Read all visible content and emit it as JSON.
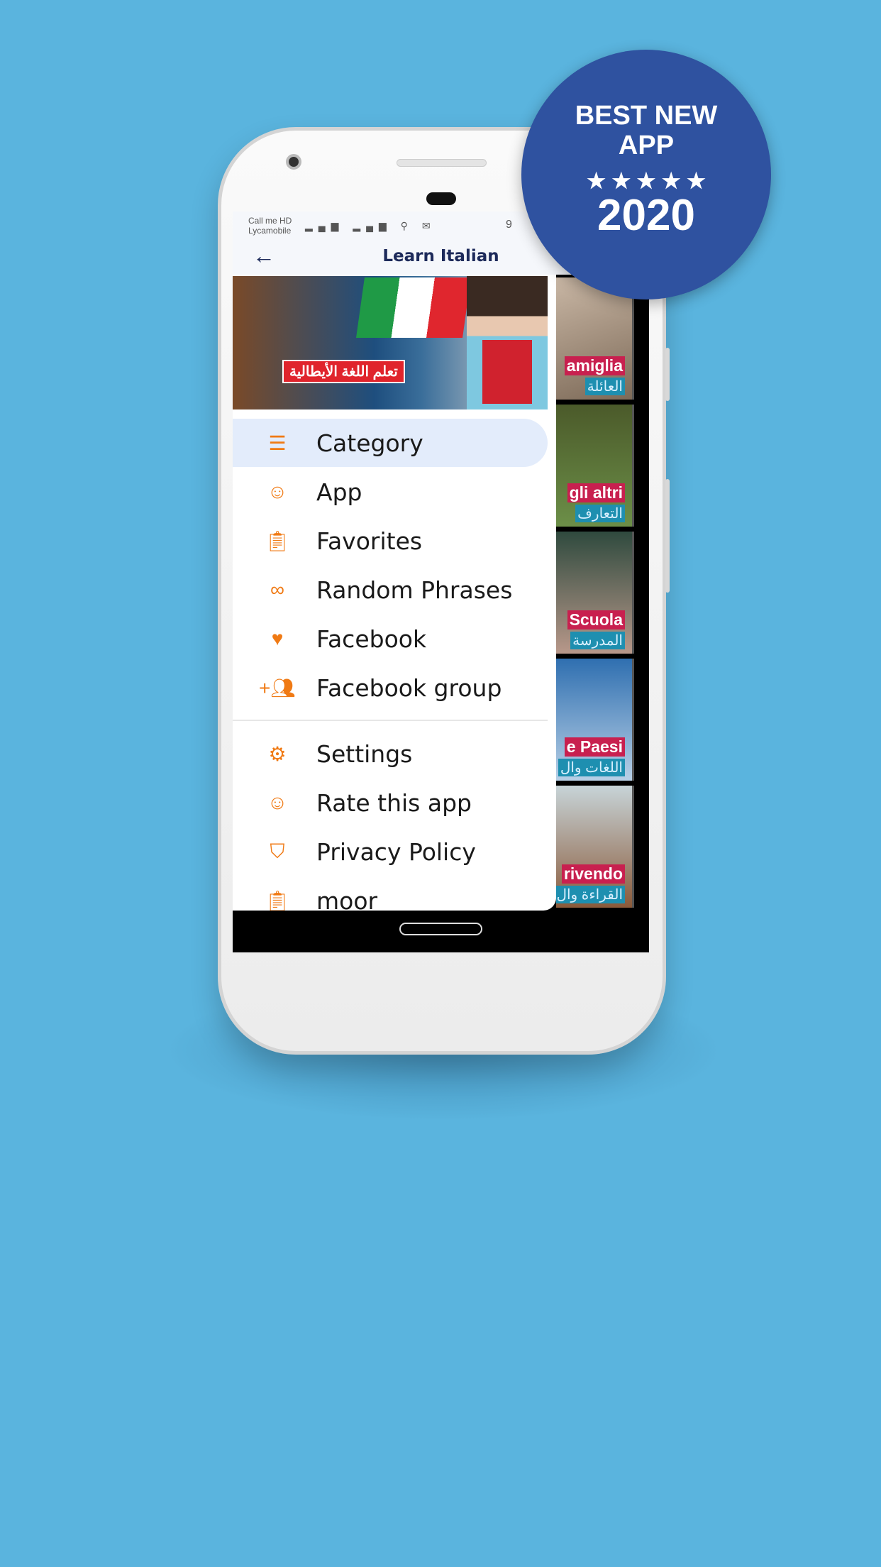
{
  "status": {
    "carrier_line1": "Call me HD",
    "carrier_line2": "Lycamobile",
    "battery": "9"
  },
  "appbar": {
    "title": "Learn Italian"
  },
  "header_banner_text": "تعلم اللغة الأيطالية",
  "drawer": {
    "items": [
      {
        "label": "Category",
        "icon": "list-icon",
        "selected": true
      },
      {
        "label": "App",
        "icon": "smiley-icon"
      },
      {
        "label": "Favorites",
        "icon": "clipboard-icon"
      },
      {
        "label": "Random Phrases",
        "icon": "infinity-icon"
      },
      {
        "label": "Facebook",
        "icon": "heart-icon"
      },
      {
        "label": "Facebook group",
        "icon": "group-add-icon"
      }
    ],
    "items2": [
      {
        "label": "Settings",
        "icon": "gear-icon"
      },
      {
        "label": "Rate this app",
        "icon": "smiley-icon"
      },
      {
        "label": "Privacy Policy",
        "icon": "shield-icon"
      },
      {
        "label": "moor",
        "icon": "clipboard-icon"
      }
    ]
  },
  "cards": [
    {
      "it": "amiglia",
      "ar": "العائلة"
    },
    {
      "it": "gli altri",
      "ar": "التعارف"
    },
    {
      "it": "Scuola",
      "ar": "المدرسة"
    },
    {
      "it": "e Paesi",
      "ar": "اللغات وال"
    },
    {
      "it": "rivendo",
      "ar": "القراءة وال"
    }
  ],
  "badge": {
    "line1": "BEST NEW",
    "line2": "APP",
    "stars": "★ ★ ★ ★ ★",
    "year": "2020"
  },
  "colors": {
    "background": "#5ab4de",
    "accent": "#f07a14",
    "badge": "#2f52a0",
    "selected": "#e3ecfb"
  }
}
